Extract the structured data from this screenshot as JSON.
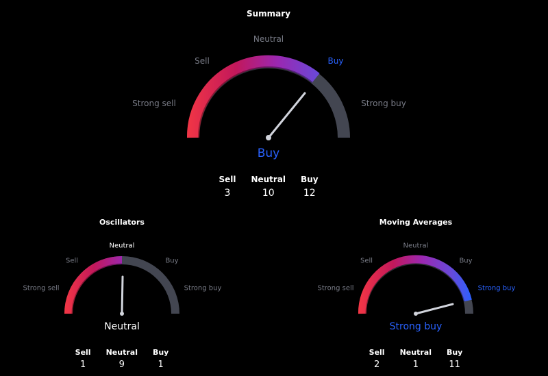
{
  "colors": {
    "strong_sell": "#f23645",
    "sell_mid": "#c2185b",
    "neutral_mid": "#9c27b0",
    "buy_mid": "#6a48d7",
    "buy_blue": "#2962ff",
    "track": "#434651",
    "needle": "#d1d4dc",
    "label_dim": "#787b86"
  },
  "summary": {
    "title": "Summary",
    "labels": {
      "strong_sell": "Strong sell",
      "sell": "Sell",
      "neutral": "Neutral",
      "buy": "Buy",
      "strong_buy": "Strong buy"
    },
    "verdict": "Buy",
    "counts": {
      "sell_label": "Sell",
      "neutral_label": "Neutral",
      "buy_label": "Buy",
      "sell": "3",
      "neutral": "10",
      "buy": "12"
    }
  },
  "oscillators": {
    "title": "Oscillators",
    "labels": {
      "strong_sell": "Strong sell",
      "sell": "Sell",
      "neutral": "Neutral",
      "buy": "Buy",
      "strong_buy": "Strong buy"
    },
    "verdict": "Neutral",
    "counts": {
      "sell_label": "Sell",
      "neutral_label": "Neutral",
      "buy_label": "Buy",
      "sell": "1",
      "neutral": "9",
      "buy": "1"
    }
  },
  "moving_averages": {
    "title": "Moving Averages",
    "labels": {
      "strong_sell": "Strong sell",
      "sell": "Sell",
      "neutral": "Neutral",
      "buy": "Buy",
      "strong_buy": "Strong buy"
    },
    "verdict": "Strong buy",
    "counts": {
      "sell_label": "Sell",
      "neutral_label": "Neutral",
      "buy_label": "Buy",
      "sell": "2",
      "neutral": "1",
      "buy": "11"
    }
  }
}
